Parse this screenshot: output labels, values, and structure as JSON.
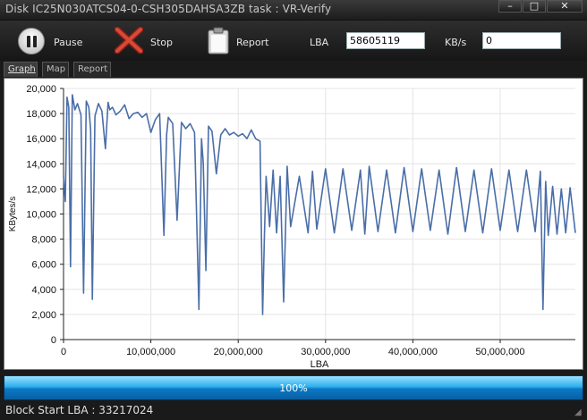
{
  "window": {
    "title": "Disk IC25N030ATCS04-0-CSH305DAHSA3ZB   task : VR-Verify",
    "min_glyph": "–",
    "max_glyph": "□",
    "close_glyph": "✕"
  },
  "toolbar": {
    "pause_label": "Pause",
    "stop_label": "Stop",
    "report_label": "Report",
    "lba_label": "LBA",
    "lba_value": "58605119",
    "kbs_label": "KB/s",
    "kbs_value": "0",
    "icons": [
      "pause-icon",
      "stop-icon",
      "report-icon"
    ],
    "stop_color": "#c0392b"
  },
  "tabs": [
    "Graph",
    "Map",
    "Report"
  ],
  "active_tab": "Graph",
  "progress": {
    "value": 1.0,
    "label": "100%"
  },
  "status": {
    "text": "Block Start LBA : 33217024"
  },
  "chart_data": {
    "type": "line",
    "title": "",
    "xlabel": "LBA",
    "ylabel": "KBytes/s",
    "xlim": [
      0,
      58605119
    ],
    "ylim": [
      0,
      20000
    ],
    "xticks": [
      0,
      10000000,
      20000000,
      30000000,
      40000000,
      50000000
    ],
    "xtick_labels": [
      "0",
      "10,000,000",
      "20,000,000",
      "30,000,000",
      "40,000,000",
      "50,000,000"
    ],
    "yticks": [
      0,
      2000,
      4000,
      6000,
      8000,
      10000,
      12000,
      14000,
      16000,
      18000,
      20000
    ],
    "ytick_labels": [
      "0",
      "2,000",
      "4,000",
      "6,000",
      "8,000",
      "10,000",
      "12,000",
      "14,000",
      "16,000",
      "18,000",
      "20,000"
    ],
    "grid": true,
    "line_color": "#4a6ea8",
    "series": [
      {
        "x": [
          0,
          200000,
          400000,
          600000,
          800000,
          1000000,
          1300000,
          1600000,
          2000000,
          2300000,
          2600000,
          2900000,
          3100000,
          3300000,
          3600000,
          4000000,
          4400000,
          4800000,
          5100000,
          5300000,
          5600000,
          6000000,
          6500000,
          7000000,
          7500000,
          8000000,
          8500000,
          9000000,
          9500000,
          10000000,
          10500000,
          11000000,
          11500000,
          11800000,
          12000000,
          12500000,
          13000000,
          13500000,
          14000000,
          14500000,
          15000000,
          15500000,
          15800000,
          16000000,
          16300000,
          16600000,
          17000000,
          17500000,
          18000000,
          18500000,
          19000000,
          19500000,
          20000000,
          20500000,
          21000000,
          21500000,
          22000000,
          22500000,
          22800000,
          23000000,
          23200000,
          23600000,
          24000000,
          24400000,
          24800000,
          25200000,
          25600000,
          26000000,
          27000000,
          28000000,
          28500000,
          29000000,
          30000000,
          31000000,
          32000000,
          33000000,
          34000000,
          34500000,
          35000000,
          36000000,
          37000000,
          38000000,
          39000000,
          40000000,
          41000000,
          42000000,
          43000000,
          44000000,
          45000000,
          46000000,
          47000000,
          48000000,
          49000000,
          50000000,
          51000000,
          52000000,
          53000000,
          54000000,
          54600000,
          54900000,
          55200000,
          55500000,
          56000000,
          56500000,
          57000000,
          57500000,
          58000000,
          58605119
        ],
        "y": [
          13000,
          11000,
          19300,
          18500,
          5800,
          19500,
          18300,
          18800,
          17900,
          3700,
          19000,
          18500,
          16700,
          3200,
          17800,
          18800,
          18200,
          15200,
          18900,
          18300,
          18500,
          17900,
          18200,
          18700,
          17600,
          18000,
          18100,
          17700,
          18000,
          16500,
          17500,
          18000,
          8300,
          16300,
          17700,
          17200,
          9500,
          17300,
          16800,
          17200,
          16500,
          2400,
          16000,
          14000,
          5500,
          17000,
          16600,
          13200,
          16300,
          16800,
          16300,
          16500,
          16200,
          16400,
          16000,
          16700,
          16000,
          15800,
          2000,
          8300,
          13000,
          9000,
          13500,
          8500,
          13000,
          3000,
          13800,
          9000,
          13000,
          8500,
          13400,
          8800,
          13600,
          8500,
          13600,
          8700,
          13500,
          8400,
          13800,
          8600,
          13500,
          8500,
          13700,
          8600,
          13600,
          8700,
          13500,
          8400,
          13700,
          8600,
          13500,
          8500,
          13600,
          8700,
          13500,
          8600,
          13500,
          8600,
          13400,
          2400,
          12600,
          8300,
          12200,
          8400,
          12000,
          8500,
          12100,
          8500
        ]
      }
    ]
  }
}
